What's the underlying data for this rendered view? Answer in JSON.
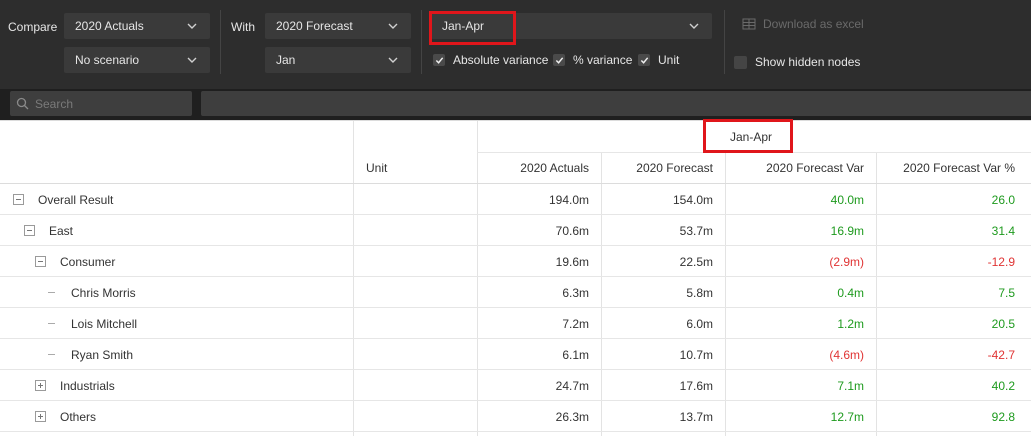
{
  "toolbar": {
    "compare_label": "Compare",
    "with_label": "With",
    "compare_primary": "2020 Actuals",
    "compare_scenario": "No scenario",
    "with_primary": "2020 Forecast",
    "with_period": "Jan",
    "range": "Jan-Apr",
    "download_label": "Download as excel",
    "checkboxes": {
      "absolute_variance": {
        "label": "Absolute variance",
        "checked": true
      },
      "percent_variance": {
        "label": "% variance",
        "checked": true
      },
      "unit": {
        "label": "Unit",
        "checked": true
      },
      "show_hidden": {
        "label": "Show hidden nodes",
        "checked": false
      }
    },
    "highlight_color": "#e0161b"
  },
  "search": {
    "placeholder": "Search"
  },
  "table": {
    "group_header": "Jan-Apr",
    "columns": {
      "unit": "Unit",
      "actuals": "2020 Actuals",
      "forecast": "2020 Forecast",
      "var": "2020 Forecast Var",
      "var_pct": "2020 Forecast Var %"
    },
    "rows": [
      {
        "label": "Overall Result",
        "level": 0,
        "toggle": "minus",
        "unit": "",
        "actuals": "194.0m",
        "forecast": "154.0m",
        "var": "40.0m",
        "var_pct": "26.0",
        "sign": "pos"
      },
      {
        "label": "East",
        "level": 1,
        "toggle": "minus",
        "unit": "",
        "actuals": "70.6m",
        "forecast": "53.7m",
        "var": "16.9m",
        "var_pct": "31.4",
        "sign": "pos"
      },
      {
        "label": "Consumer",
        "level": 2,
        "toggle": "minus",
        "unit": "",
        "actuals": "19.6m",
        "forecast": "22.5m",
        "var": "(2.9m)",
        "var_pct": "-12.9",
        "sign": "neg"
      },
      {
        "label": "Chris Morris",
        "level": 3,
        "toggle": "leaf",
        "unit": "",
        "actuals": "6.3m",
        "forecast": "5.8m",
        "var": "0.4m",
        "var_pct": "7.5",
        "sign": "pos"
      },
      {
        "label": "Lois Mitchell",
        "level": 3,
        "toggle": "leaf",
        "unit": "",
        "actuals": "7.2m",
        "forecast": "6.0m",
        "var": "1.2m",
        "var_pct": "20.5",
        "sign": "pos"
      },
      {
        "label": "Ryan Smith",
        "level": 3,
        "toggle": "leaf",
        "unit": "",
        "actuals": "6.1m",
        "forecast": "10.7m",
        "var": "(4.6m)",
        "var_pct": "-42.7",
        "sign": "neg"
      },
      {
        "label": "Industrials",
        "level": 2,
        "toggle": "plus",
        "unit": "",
        "actuals": "24.7m",
        "forecast": "17.6m",
        "var": "7.1m",
        "var_pct": "40.2",
        "sign": "pos"
      },
      {
        "label": "Others",
        "level": 2,
        "toggle": "plus",
        "unit": "",
        "actuals": "26.3m",
        "forecast": "13.7m",
        "var": "12.7m",
        "var_pct": "92.8",
        "sign": "pos"
      }
    ],
    "colors": {
      "positive": "#1e9a1e",
      "negative": "#e03434"
    }
  }
}
